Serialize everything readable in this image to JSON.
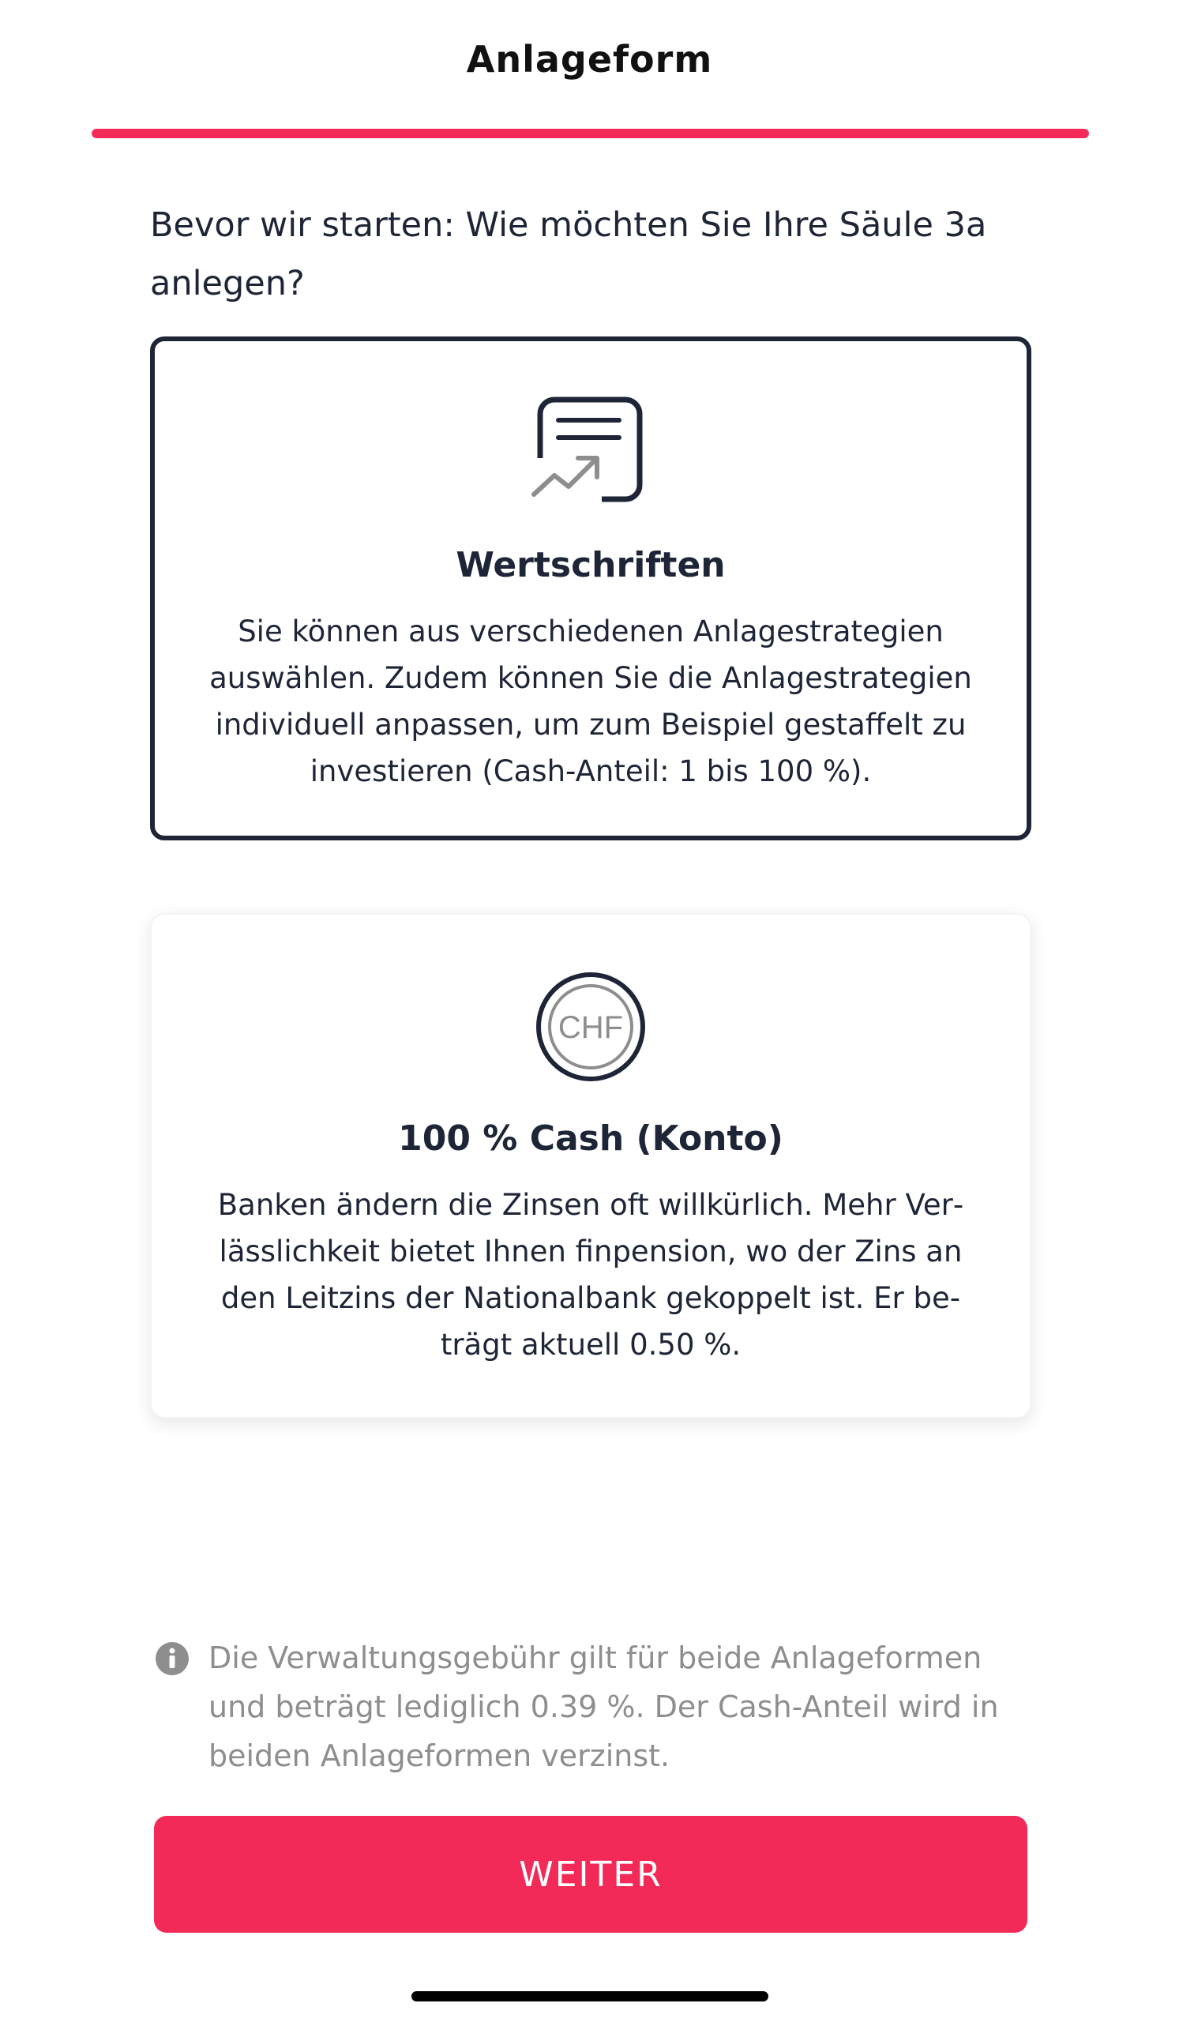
{
  "header": {
    "title": "Anlageform"
  },
  "progress": {
    "percent": 100,
    "color": "#f32a57"
  },
  "question": "Bevor wir starten: Wie möchten Sie Ihre Säule 3a anlegen?",
  "options": [
    {
      "icon": "document-chart-icon",
      "title": "Wertschriften",
      "description": "Sie können aus verschiedenen Anlagestrategien auswählen. Zudem können Sie die Anlagestrategi­en individuell anpassen, um zum Beispiel gestaffelt zu investieren (Cash-Anteil: 1 bis 100 %).",
      "selected": true
    },
    {
      "icon": "chf-coin-icon",
      "icon_text": "CHF",
      "title": "100 % Cash (Konto)",
      "description": "Banken ändern die Zinsen oft willkürlich. Mehr Ver­lässlichkeit bietet Ihnen finpension, wo der Zins an den Leitzins der Nationalbank gekoppelt ist. Er be­trägt aktuell 0.50 %.",
      "selected": false
    }
  ],
  "info": {
    "icon": "info-icon",
    "text": "Die Verwaltungsgebühr gilt für beide Anlageformen und beträgt lediglich 0.39 %. Der Cash-Anteil wird in beiden Anlageformen verzinst."
  },
  "continue_label": "WEITER",
  "colors": {
    "accent": "#f32a57",
    "text": "#1d2536",
    "muted": "#8e8e8e"
  }
}
